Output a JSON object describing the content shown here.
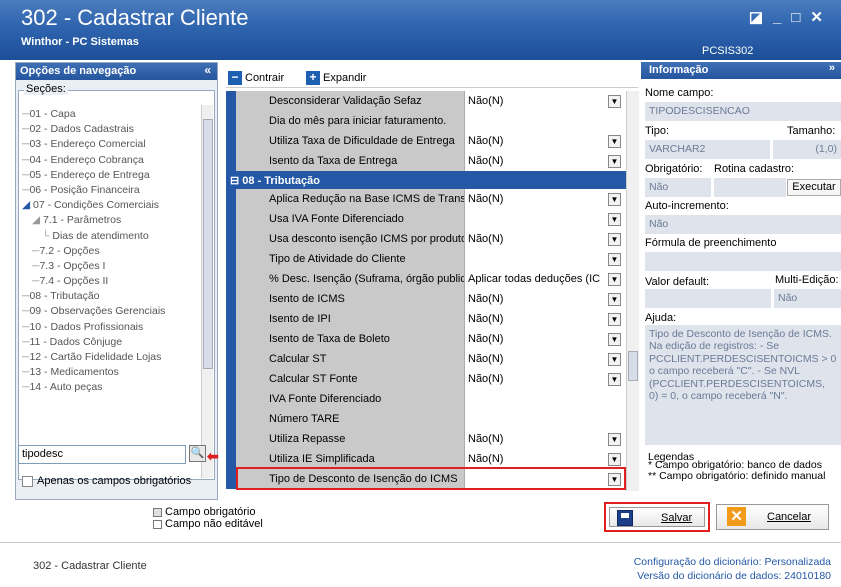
{
  "window": {
    "title": "302 - Cadastrar Cliente",
    "subtitle": "Winthor - PC Sistemas",
    "code": "PCSIS302"
  },
  "nav": {
    "header": "Opções de navegação",
    "collapse": "«",
    "sections_label": "Seções:",
    "items": [
      "01 - Capa",
      "02 - Dados Cadastrais",
      "03 - Endereço Comercial",
      "04 - Endereço Cobrança",
      "05 - Endereço de Entrega",
      "06 - Posição Financeira",
      "07 - Condições Comerciais",
      "7.1 - Parâmetros",
      "Dias de atendimento",
      "7.2 - Opções",
      "7.3 - Opções I",
      "7.4 - Opções II",
      "08 - Tributação",
      "09 - Observações Gerenciais",
      "10 - Dados Profissionais",
      "11 - Dados Cônjuge",
      "12 - Cartão Fidelidade Lojas",
      "13 - Medicamentos",
      "14 - Auto peças"
    ],
    "search_value": "tipodesc",
    "required_only": "Apenas os campos obrigatórios"
  },
  "toolbar": {
    "collapse": "Contrair",
    "expand": "Expandir"
  },
  "grid": {
    "rows_before": [
      {
        "label": "Desconsiderar Validação Sefaz",
        "value": "Não(N)",
        "dropdown": true
      },
      {
        "label": "Dia do mês para iniciar faturamento.",
        "value": "",
        "dropdown": false
      },
      {
        "label": "Utiliza Taxa de Dificuldade de Entrega",
        "value": "Não(N)",
        "dropdown": true
      },
      {
        "label": "Isento da Taxa de Entrega",
        "value": "Não(N)",
        "dropdown": true
      }
    ],
    "group": "08 - Tributação",
    "rows_after": [
      {
        "label": "Aplica Redução na Base ICMS de Transpo",
        "value": "Não(N)",
        "dropdown": true
      },
      {
        "label": "Usa IVA Fonte Diferenciado",
        "value": "",
        "dropdown": true
      },
      {
        "label": "Usa desconto isenção ICMS por produto",
        "value": "Não(N)",
        "dropdown": true
      },
      {
        "label": "Tipo de Atividade do Cliente",
        "value": "",
        "dropdown": true
      },
      {
        "label": "% Desc. Isenção (Suframa, órgão publico",
        "value": "Aplicar todas deduções (IC",
        "dropdown": true
      },
      {
        "label": "Isento de ICMS",
        "value": "Não(N)",
        "dropdown": true
      },
      {
        "label": "Isento de IPI",
        "value": "Não(N)",
        "dropdown": true
      },
      {
        "label": "Isento de Taxa de Boleto",
        "value": "Não(N)",
        "dropdown": true
      },
      {
        "label": "Calcular ST",
        "value": "Não(N)",
        "dropdown": true
      },
      {
        "label": "Calcular ST Fonte",
        "value": "Não(N)",
        "dropdown": true
      },
      {
        "label": "IVA Fonte Diferenciado",
        "value": "",
        "dropdown": false
      },
      {
        "label": "Número TARE",
        "value": "",
        "dropdown": false
      },
      {
        "label": "Utiliza Repasse",
        "value": "Não(N)",
        "dropdown": true
      },
      {
        "label": "Utiliza IE Simplificada",
        "value": "Não(N)",
        "dropdown": true
      },
      {
        "label": "Tipo de Desconto de Isenção do ICMS",
        "value": "",
        "dropdown": true
      }
    ]
  },
  "info": {
    "header": "Informação",
    "expand": "»",
    "field_name_label": "Nome campo:",
    "field_name": "TIPODESCISENCAO",
    "type_label": "Tipo:",
    "size_label": "Tamanho:",
    "type": "VARCHAR2",
    "size": "(1,0)",
    "required_label": "Obrigatório:",
    "routine_label": "Rotina cadastro:",
    "required": "Não",
    "execute": "Executar",
    "autoinc_label": "Auto-incremento:",
    "autoinc": "Não",
    "formula_label": "Fórmula de preenchimento",
    "default_label": "Valor default:",
    "multi_label": "Multi-Edição:",
    "multi": "Não",
    "help_label": "Ajuda:",
    "help": "Tipo de Desconto de Isenção de ICMS. Na edição de registros: - Se PCCLIENT.PERDESCISENTOICMS > 0 o campo receberá \"C\". - Se NVL (PCCLIENT.PERDESCISENTOICMS, 0) = 0, o campo receberá \"N\".",
    "legend_title": "Legendas",
    "legend1": "* Campo obrigatório: banco de dados",
    "legend2": "** Campo obrigatório: definido manual"
  },
  "bottom": {
    "required_field": "Campo obrigatório",
    "non_editable": "Campo não editável",
    "save": "Salvar",
    "cancel": "Cancelar"
  },
  "footer": {
    "left": "302 - Cadastrar Cliente",
    "dict_config_label": "Configuração do dicionário:",
    "dict_config": "Personalizada",
    "dict_version_label": "Versão do dicionário de dados:",
    "dict_version": "24010180"
  }
}
